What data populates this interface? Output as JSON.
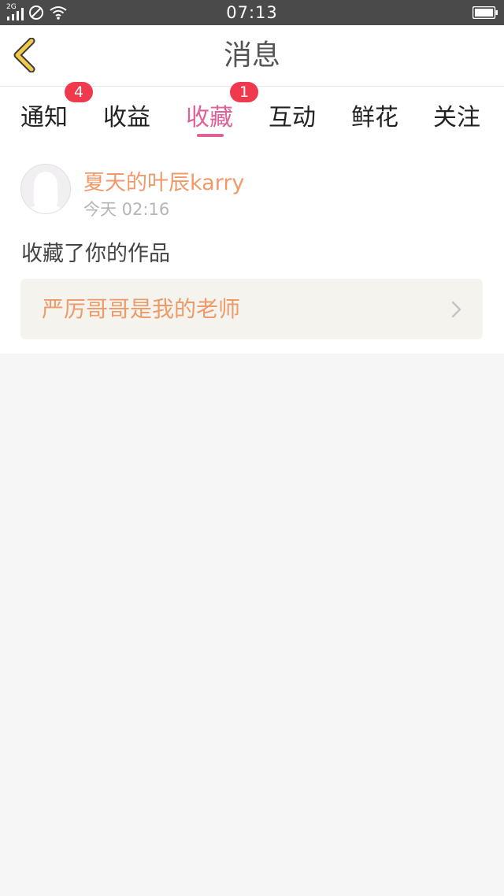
{
  "status_bar": {
    "time": "07:13",
    "network": "2G"
  },
  "header": {
    "title": "消息"
  },
  "tabs": [
    {
      "label": "通知",
      "badge": "4",
      "active": false
    },
    {
      "label": "收益",
      "badge": "",
      "active": false
    },
    {
      "label": "收藏",
      "badge": "1",
      "active": true
    },
    {
      "label": "互动",
      "badge": "",
      "active": false
    },
    {
      "label": "鲜花",
      "badge": "",
      "active": false
    },
    {
      "label": "关注",
      "badge": "",
      "active": false
    }
  ],
  "message": {
    "username": "夏天的叶辰karry",
    "timestamp": "今天 02:16",
    "action": "收藏了你的作品",
    "work_title": "严厉哥哥是我的老师"
  },
  "colors": {
    "accent": "#e0609a",
    "username": "#f09a6a",
    "badge": "#f0394d",
    "back_icon": "#f2c94c"
  }
}
